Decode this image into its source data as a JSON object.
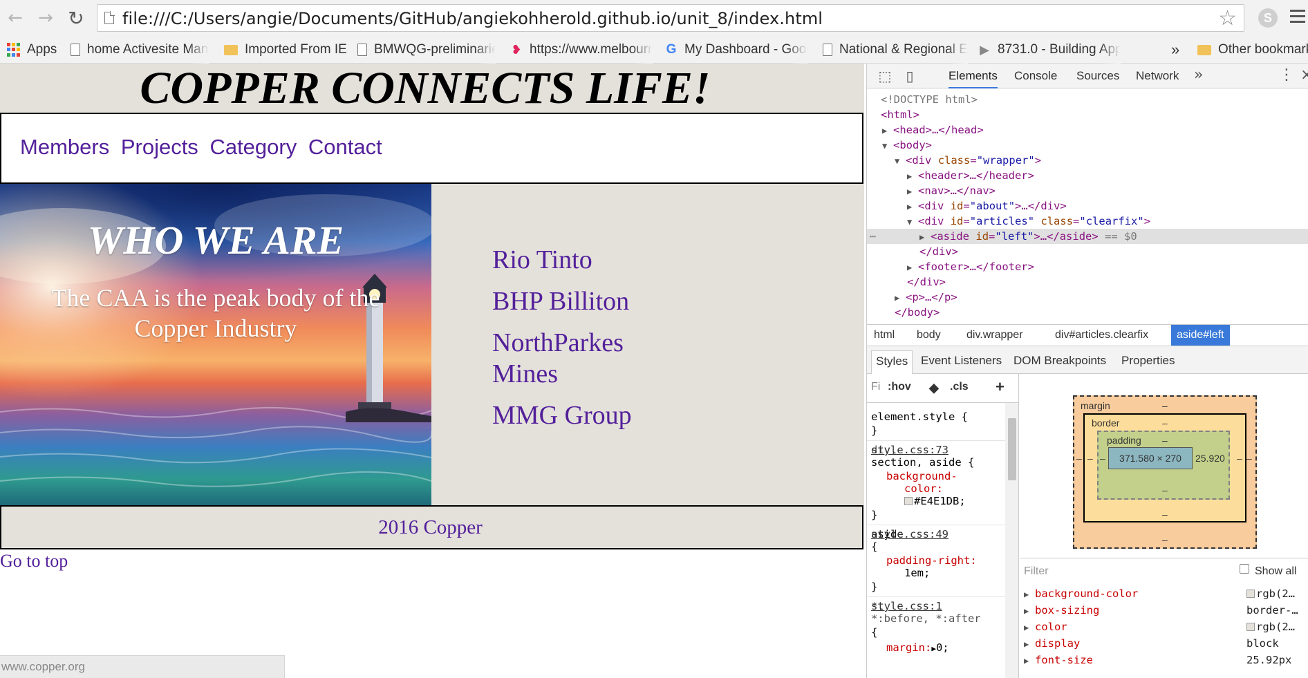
{
  "browser": {
    "url": "file:///C:/Users/angie/Documents/GitHub/angiekohherold.github.io/unit_8/index.html",
    "nav_icons": [
      "back-arrow-icon",
      "forward-arrow-icon",
      "reload-icon"
    ],
    "bookmarks": [
      {
        "label": "Apps",
        "icon": "apps-icon"
      },
      {
        "label": "home Activesite Mana",
        "icon": "page-icon"
      },
      {
        "label": "Imported From IE",
        "icon": "folder-icon"
      },
      {
        "label": "BMWQG-preliminarie",
        "icon": "page-icon"
      },
      {
        "label": "https://www.melbourn",
        "icon": "lips-icon"
      },
      {
        "label": "My Dashboard - Goog",
        "icon": "google-icon"
      },
      {
        "label": "National & Regional E",
        "icon": "page-icon"
      },
      {
        "label": "8731.0 - Building App",
        "icon": "flag-icon"
      }
    ],
    "overflow": "»",
    "other_bookmarks": "Other bookmarks",
    "status_url": "www.copper.org"
  },
  "site": {
    "title": "COPPER CONNECTS LIFE!",
    "nav_links": [
      "Members",
      "Projects",
      "Category",
      "Contact"
    ],
    "hero_title": "WHO WE ARE",
    "hero_text": "The CAA is the peak body of the Copper Industry",
    "members": [
      "Rio Tinto",
      "BHP Billiton",
      "NorthParkes Mines",
      "MMG Group"
    ],
    "footer": "2016 Copper",
    "go_top": "Go to top",
    "bg_color": "#E4E1DB",
    "link_color": "#53209a"
  },
  "devtools": {
    "tabs": [
      "Elements",
      "Console",
      "Sources",
      "Network"
    ],
    "active_tab": "Elements",
    "dom": {
      "doctype": "<!DOCTYPE html>",
      "html_open": "<html>",
      "head": "<head>…</head>",
      "body_open": "<body>",
      "wrapper_open": "<div class=\"wrapper\">",
      "wrapper_tag": "div",
      "wrapper_attr": "class",
      "wrapper_val": "\"wrapper\"",
      "header": "<header>…</header>",
      "nav": "<nav>…</nav>",
      "about_tag": "div",
      "about_attr": "id",
      "about_val": "\"about\"",
      "articles_tag": "div",
      "articles_id_attr": "id",
      "articles_id_val": "\"articles\"",
      "articles_class_attr": "class",
      "articles_class_val": "\"clearfix\"",
      "aside_tag": "aside",
      "aside_attr": "id",
      "aside_val": "\"left\"",
      "aside_marker": "== $0",
      "close_div": "</div>",
      "footer": "<footer>…</footer>",
      "p": "<p>…</p>",
      "close_body": "</body>",
      "ellipsis": "…",
      "dots": "⋯"
    },
    "breadcrumbs": [
      "html",
      "body",
      "div.wrapper",
      "div#articles.clearfix",
      "aside#left"
    ],
    "sub_tabs": [
      "Styles",
      "Event Listeners",
      "DOM Breakpoints",
      "Properties"
    ],
    "styles_filter": {
      "filter": "Fi",
      "hov": ":hov",
      "cls": ".cls",
      "add": "+"
    },
    "rules": {
      "element_style": "element.style {",
      "close": "}",
      "r1_sel1": "div,",
      "r1_src": "style.css:73",
      "r1_sel2": "section, aside {",
      "r1_prop": "background-",
      "r1_prop2": "color:",
      "r1_val": "#E4E1DB;",
      "r2_sel": "aside",
      "r2_src": "style.css:49",
      "r2_open": "{",
      "r2_prop": "padding-right:",
      "r2_val": "1em;",
      "r3_sel1": "*,",
      "r3_src": "style.css:1",
      "r3_sel2": "*:before, *:after",
      "r3_open": "{",
      "r3_prop": "margin:",
      "r3_val": "0;",
      "r3_arrow": "▶"
    },
    "box_model": {
      "margin": "margin",
      "border": "border",
      "padding": "padding",
      "content": "371.580 × 270",
      "padding_right": "25.920",
      "dash": "–"
    },
    "computed_filter": "Filter",
    "show_all": "Show all",
    "computed": [
      {
        "prop": "background-color",
        "val": "rgb(2…",
        "swatch": true
      },
      {
        "prop": "box-sizing",
        "val": "border-…",
        "swatch": false
      },
      {
        "prop": "color",
        "val": "rgb(2…",
        "swatch": true
      },
      {
        "prop": "display",
        "val": "block",
        "swatch": false
      },
      {
        "prop": "font-size",
        "val": "25.92px",
        "swatch": false
      }
    ]
  }
}
